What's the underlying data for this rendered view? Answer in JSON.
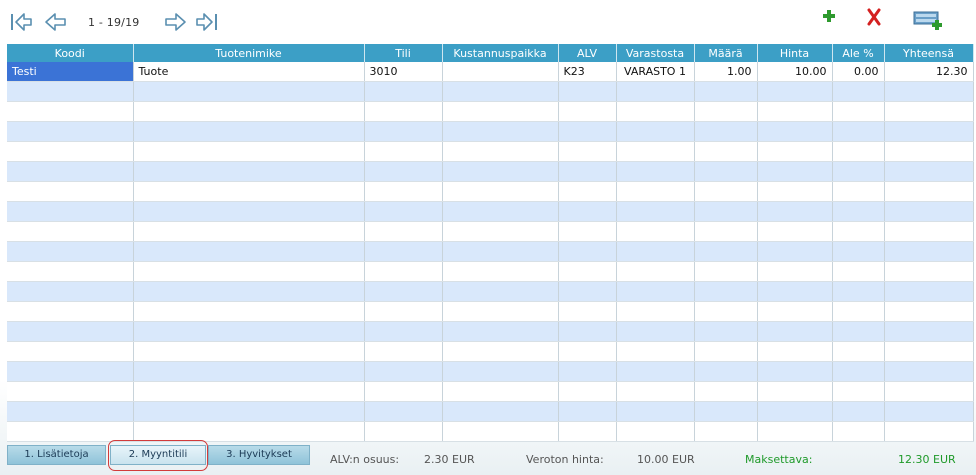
{
  "pager": {
    "range": "1 - 19/19"
  },
  "icons": {
    "first": "first-page-icon",
    "prev": "previous-arrow-icon",
    "next": "next-arrow-icon",
    "last": "last-page-icon",
    "add": "add-plus-icon",
    "delete": "delete-x-icon",
    "add_row": "add-row-table-icon"
  },
  "colors": {
    "header": "#3c9fc6",
    "row_alt": "#d9e8fb",
    "selection": "#3b73d6",
    "payable": "#1f9a2a"
  },
  "table": {
    "headers": [
      "Koodi",
      "Tuotenimike",
      "Tili",
      "Kustannuspaikka",
      "ALV",
      "Varastosta",
      "Määrä",
      "Hinta",
      "Ale %",
      "Yhteensä"
    ],
    "rows": [
      [
        "Testi",
        "Tuote",
        "3010",
        "",
        "K23",
        "VARASTO 1",
        "1.00",
        "10.00",
        "0.00",
        "12.30"
      ]
    ]
  },
  "tabs": [
    "1. Lisätietoja",
    "2. Myyntitili",
    "3. Hyvitykset"
  ],
  "summary": {
    "vat_label": "ALV:n osuus:",
    "vat_value": "2.30 EUR",
    "net_label": "Veroton hinta:",
    "net_value": "10.00 EUR",
    "pay_label": "Maksettava:",
    "pay_value": "12.30 EUR"
  }
}
